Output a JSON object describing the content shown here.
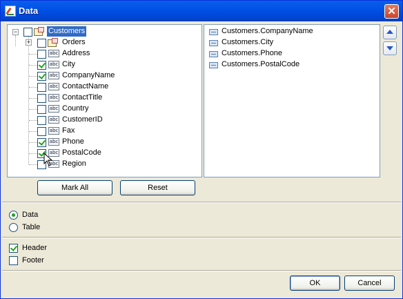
{
  "window": {
    "title": "Data",
    "close_symbol": "✕"
  },
  "tree": {
    "root": {
      "label": "Customers",
      "expander": "−",
      "checked": false
    },
    "orders": {
      "label": "Orders",
      "expander": "+",
      "checked": false
    },
    "fields": [
      {
        "label": "Address",
        "checked": false
      },
      {
        "label": "City",
        "checked": true
      },
      {
        "label": "CompanyName",
        "checked": true
      },
      {
        "label": "ContactName",
        "checked": false
      },
      {
        "label": "ContactTitle",
        "checked": false
      },
      {
        "label": "Country",
        "checked": false
      },
      {
        "label": "CustomerID",
        "checked": false
      },
      {
        "label": "Fax",
        "checked": false
      },
      {
        "label": "Phone",
        "checked": true
      },
      {
        "label": "PostalCode",
        "checked": true
      },
      {
        "label": "Region",
        "checked": false
      }
    ],
    "field_icon_text": "abc"
  },
  "selected_fields": [
    "Customers.CompanyName",
    "Customers.City",
    "Customers.Phone",
    "Customers.PostalCode"
  ],
  "buttons": {
    "mark_all": "Mark All",
    "reset": "Reset",
    "ok": "OK",
    "cancel": "Cancel"
  },
  "mode": {
    "options": [
      {
        "label": "Data",
        "selected": true
      },
      {
        "label": "Table",
        "selected": false
      }
    ]
  },
  "options": {
    "header": {
      "label": "Header",
      "checked": true
    },
    "footer": {
      "label": "Footer",
      "checked": false
    }
  },
  "colors": {
    "accent": "#316AC5",
    "check": "#21A121",
    "titlebar": "#0050E6"
  }
}
